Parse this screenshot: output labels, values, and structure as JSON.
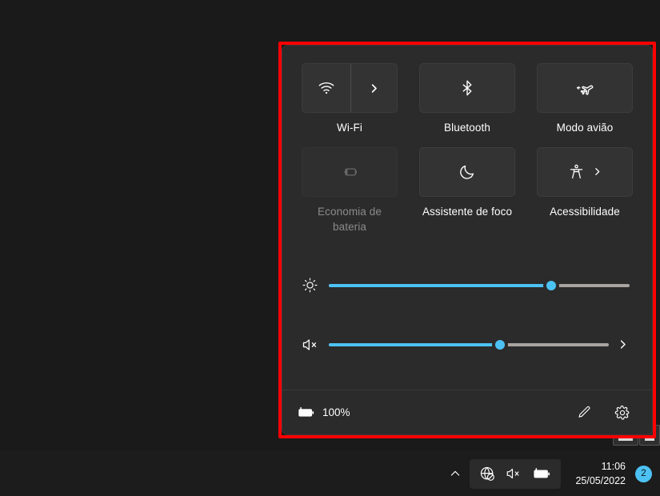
{
  "theme": {
    "desktop_bg": "#1a1a1a",
    "panel_bg": "#2b2b2b",
    "tile_bg": "#333333",
    "accent": "#4cc2f4",
    "slider_track": "#a9a4a0",
    "annotation_color": "#ff0000",
    "text_primary": "#ffffff",
    "text_disabled": "#8b8b8b"
  },
  "quick_settings": {
    "tiles": [
      {
        "label": "Wi-Fi",
        "icon": "wifi-icon",
        "style": "split",
        "has_chevron": true,
        "enabled": true
      },
      {
        "label": "Bluetooth",
        "icon": "bluetooth-icon",
        "style": "plain",
        "has_chevron": false,
        "enabled": true
      },
      {
        "label": "Modo avião",
        "icon": "airplane-icon",
        "style": "plain",
        "has_chevron": false,
        "enabled": true
      },
      {
        "label": "Economia de bateria",
        "icon": "battery-saver-icon",
        "style": "plain",
        "has_chevron": false,
        "enabled": false
      },
      {
        "label": "Assistente de foco",
        "icon": "moon-icon",
        "style": "plain",
        "has_chevron": false,
        "enabled": true
      },
      {
        "label": "Acessibilidade",
        "icon": "accessibility-icon",
        "style": "inline-chevron",
        "has_chevron": true,
        "enabled": true
      }
    ],
    "sliders": [
      {
        "name": "brightness",
        "icon": "brightness-sun-icon",
        "value": 74,
        "min": 0,
        "max": 100,
        "has_expand": false
      },
      {
        "name": "volume",
        "icon": "volume-muted-icon",
        "value": 61,
        "min": 0,
        "max": 100,
        "has_expand": true,
        "expand_icon": "chevron-right-icon"
      }
    ],
    "footer": {
      "battery_icon": "battery-charging-icon",
      "battery_percent": "100%",
      "edit_icon": "pencil-icon",
      "settings_icon": "gear-icon"
    }
  },
  "taskbar": {
    "tray_chevron_icon": "chevron-up-icon",
    "tray_icons": [
      "globe-no-internet-icon",
      "volume-muted-icon",
      "battery-charging-icon"
    ],
    "clock": {
      "time": "11:06",
      "date": "25/05/2022"
    },
    "notification_count": "2"
  }
}
